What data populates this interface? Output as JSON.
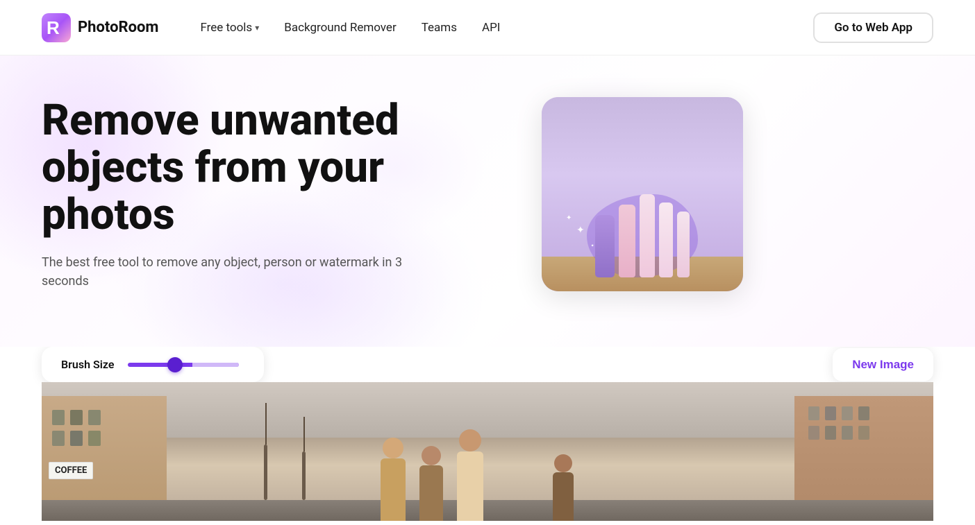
{
  "nav": {
    "logo_text": "PhotoRoom",
    "free_tools_label": "Free tools",
    "background_remover_label": "Background Remover",
    "teams_label": "Teams",
    "api_label": "API",
    "cta_label": "Go to Web App"
  },
  "hero": {
    "title": "Remove unwanted objects from your photos",
    "subtitle": "The best free tool to remove any object, person or watermark in 3 seconds"
  },
  "tool": {
    "brush_size_label": "Brush Size",
    "new_image_label": "New Image",
    "slider_value": 42
  },
  "coffee_sign": "COFFEE"
}
